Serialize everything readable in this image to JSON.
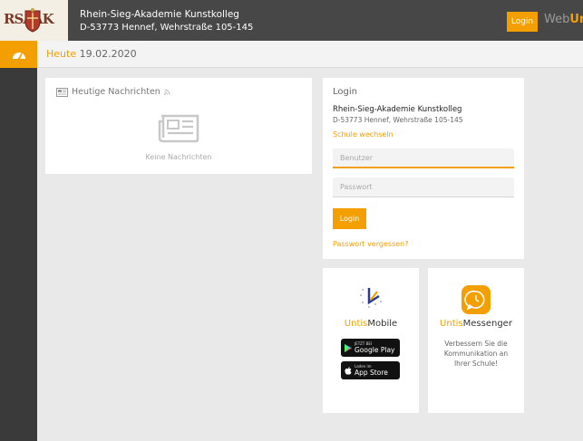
{
  "header": {
    "logo_text": "RSAAK",
    "school_name": "Rhein-Sieg-Akademie Kunstkolleg",
    "school_address": "D-53773 Hennef, Wehrstraße 105-145",
    "login_label": "Login",
    "brand_web": "Web",
    "brand_untis": "Unt"
  },
  "datebar": {
    "today_label": "Heute",
    "date": "19.02.2020"
  },
  "news": {
    "title": "Heutige Nachrichten",
    "empty_text": "Keine Nachrichten"
  },
  "login": {
    "title": "Login",
    "school_name": "Rhein-Sieg-Akademie Kunstkolleg",
    "school_address": "D-53773 Hennef, Wehrstraße 105-145",
    "switch_school": "Schule wechseln",
    "username_placeholder": "Benutzer",
    "password_placeholder": "Passwort",
    "button_label": "Login",
    "forgot_password": "Passwort vergessen?"
  },
  "apps": {
    "mobile": {
      "title_prefix": "Untis",
      "title_suffix": "Mobile",
      "google_small": "JETZT BEI",
      "google_big": "Google Play",
      "apple_small": "Laden im",
      "apple_big": "App Store"
    },
    "messenger": {
      "title_prefix": "Untis",
      "title_suffix": "Messenger",
      "description": "Verbessern Sie die Kommunikation an Ihrer Schule!"
    }
  },
  "colors": {
    "accent": "#f49f00",
    "header_bg": "#474747",
    "sidebar_bg": "#3a3a3a",
    "page_bg": "#e9e9e9"
  },
  "icons": {
    "sidebar_top": "dashboard-icon",
    "news_header": "newspaper-icon",
    "news_feed": "rss-icon",
    "news_empty": "newspaper-icon",
    "mobile_app": "untis-mobile-logo-icon",
    "messenger_app": "chat-bubble-icon",
    "google_play": "play-icon",
    "app_store": "apple-icon"
  }
}
